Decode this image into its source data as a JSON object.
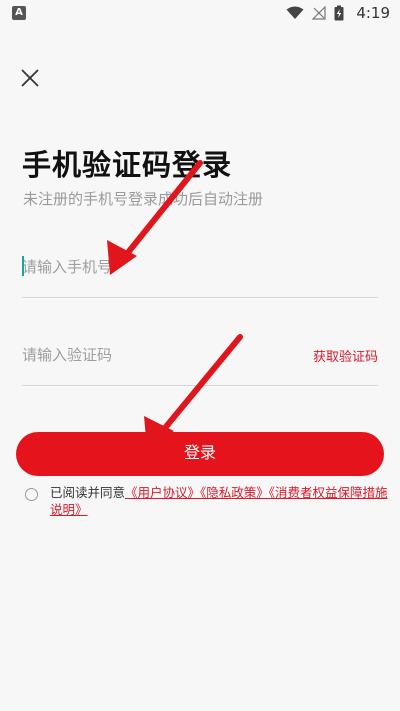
{
  "status_bar": {
    "left_icon": "A",
    "time": "4:19",
    "icons": [
      "wifi-icon",
      "no-signal-icon",
      "battery-charging-icon"
    ]
  },
  "header": {
    "close_icon": "close-icon"
  },
  "title": "手机验证码登录",
  "subtitle": "未注册的手机号登录成功后自动注册",
  "phone_field": {
    "placeholder": "请输入手机号",
    "value": ""
  },
  "code_field": {
    "placeholder": "请输入验证码",
    "value": "",
    "get_code_label": "获取验证码"
  },
  "login_button": "登录",
  "agreement": {
    "prefix": "已阅读并同意",
    "links": [
      "《用户协议》",
      "《隐私政策》",
      "《消费者权益保障措施说明》"
    ]
  },
  "colors": {
    "accent": "#e5141c",
    "caret": "#1aa896",
    "background": "#f7f7f7"
  }
}
